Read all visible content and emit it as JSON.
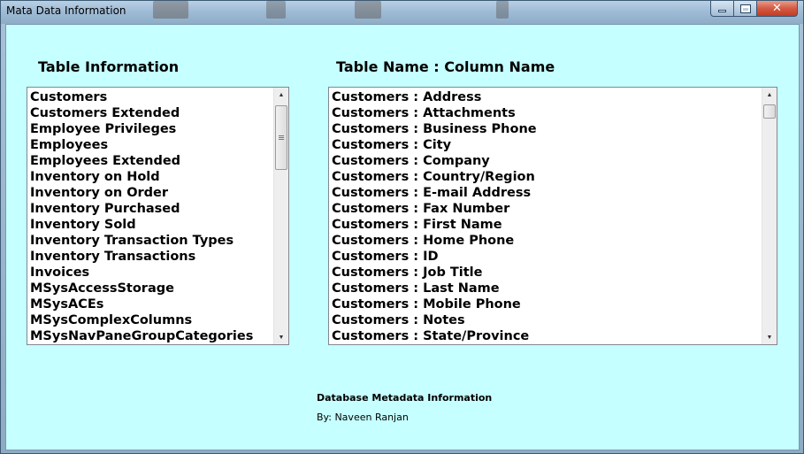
{
  "window": {
    "title": "Mata Data Information",
    "controls": {
      "minimize_icon": "minimize-icon",
      "maximize_icon": "maximize-icon",
      "close_glyph": "✕"
    }
  },
  "labels": {
    "table_information": "Table Information",
    "table_column": "Table Name  :  Column Name"
  },
  "tables_list": {
    "items": [
      "Customers",
      "Customers Extended",
      "Employee Privileges",
      "Employees",
      "Employees Extended",
      "Inventory on Hold",
      "Inventory on Order",
      "Inventory Purchased",
      "Inventory Sold",
      "Inventory Transaction Types",
      "Inventory Transactions",
      "Invoices",
      "MSysAccessStorage",
      "MSysACEs",
      "MSysComplexColumns",
      "MSysNavPaneGroupCategories"
    ]
  },
  "columns_list": {
    "items": [
      "Customers : Address",
      "Customers : Attachments",
      "Customers : Business Phone",
      "Customers : City",
      "Customers : Company",
      "Customers : Country/Region",
      "Customers : E-mail Address",
      "Customers : Fax Number",
      "Customers : First Name",
      "Customers : Home Phone",
      "Customers : ID",
      "Customers : Job Title",
      "Customers : Last Name",
      "Customers : Mobile Phone",
      "Customers : Notes",
      "Customers : State/Province"
    ]
  },
  "scroll_arrows": {
    "up": "▲",
    "down": "▼"
  },
  "footer": {
    "title": "Database Metadata  Information",
    "author": "By: Naveen Ranjan"
  },
  "colors": {
    "client_background": "#c5ffff",
    "close_button": "#c33c22"
  }
}
